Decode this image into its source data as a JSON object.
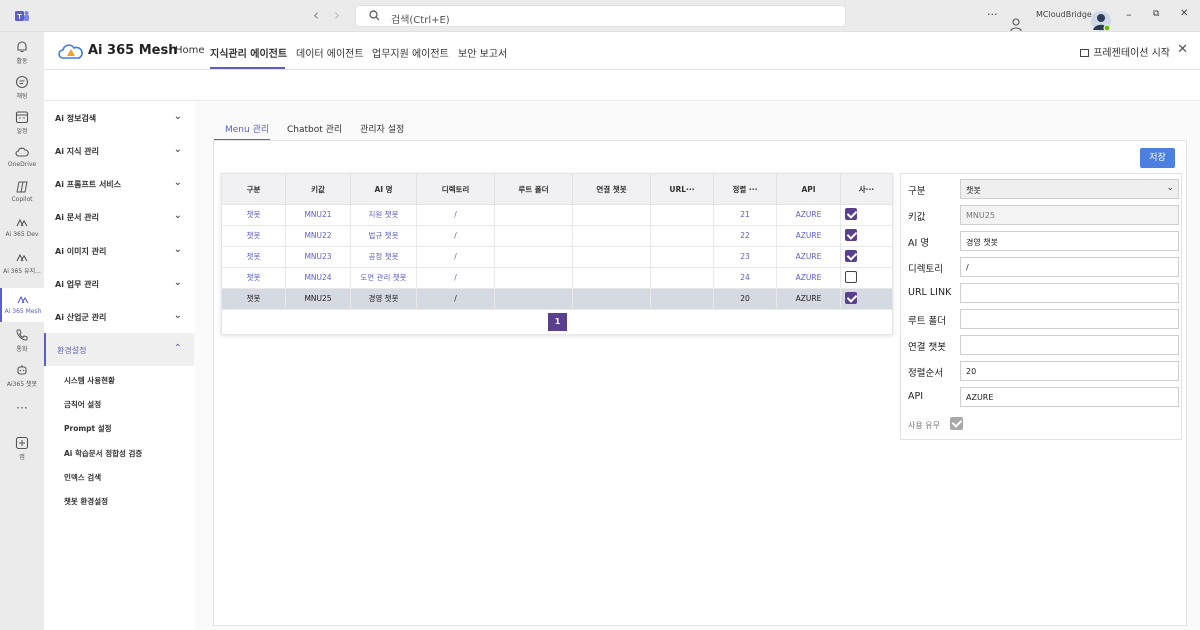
{
  "titlebar": {
    "search_placeholder": "검색(Ctrl+E)",
    "account": "MCloudBridge",
    "more": "···",
    "minimize": "–",
    "restore": "⧉",
    "close": "✕"
  },
  "rail": [
    {
      "label": "활동",
      "icon": "bell-icon"
    },
    {
      "label": "채팅",
      "icon": "chat-icon"
    },
    {
      "label": "일정",
      "icon": "calendar-icon"
    },
    {
      "label": "OneDrive",
      "icon": "cloud-icon"
    },
    {
      "label": "Copilot",
      "icon": "copilot-icon"
    },
    {
      "label": "Ai 365 Dev",
      "icon": "mesh-icon"
    },
    {
      "label": "Ai 365 유지...",
      "icon": "mesh-icon"
    },
    {
      "label": "Ai 365 Mesh",
      "icon": "mesh-icon"
    },
    {
      "label": "통화",
      "icon": "phone-icon"
    },
    {
      "label": "Ai365 챗봇",
      "icon": "bot-icon"
    },
    {
      "label": "",
      "icon": "more-icon"
    },
    {
      "label": "앱",
      "icon": "apps-icon"
    }
  ],
  "header": {
    "brand": "Ai 365 Mesh",
    "nav": [
      "Home",
      "지식관리 에이전트",
      "데이터 에이전트",
      "업무지원 에이전트",
      "보안 보고서"
    ],
    "present": "프레젠테이션 시작",
    "close": "✕"
  },
  "sidebar": {
    "items": [
      "Ai 정보검색",
      "Ai 지식 관리",
      "Ai 프롬프트 서비스",
      "Ai 문서 관리",
      "Ai 이미지 관리",
      "Ai 업무 관리",
      "Ai 산업군 관리",
      "환경설정"
    ],
    "sub_items": [
      "시스템 사용현황",
      "금칙어 설정",
      "Prompt 설정",
      "Ai 학습문서 정합성 검증",
      "인덱스 검색",
      "챗봇 환경설정"
    ],
    "chevron_down": "⌄",
    "chevron_up": "⌃"
  },
  "tabs": [
    "Menu 관리",
    "Chatbot 관리",
    "관리자 설정"
  ],
  "save_label": "저장",
  "table": {
    "columns": [
      "구분",
      "키값",
      "AI 명",
      "디렉토리",
      "루트 폴더",
      "연결 챗봇",
      "URL···",
      "정렬 ···",
      "API",
      "사···"
    ],
    "rows": [
      {
        "cat": "챗봇",
        "key": "MNU21",
        "name": "지원 챗봇",
        "dir": "/",
        "root": "",
        "link": "",
        "url": "",
        "order": "21",
        "api": "AZURE",
        "use": true
      },
      {
        "cat": "챗봇",
        "key": "MNU22",
        "name": "법규 챗봇",
        "dir": "/",
        "root": "",
        "link": "",
        "url": "",
        "order": "22",
        "api": "AZURE",
        "use": true
      },
      {
        "cat": "챗봇",
        "key": "MNU23",
        "name": "공정 챗봇",
        "dir": "/",
        "root": "",
        "link": "",
        "url": "",
        "order": "23",
        "api": "AZURE",
        "use": true
      },
      {
        "cat": "챗봇",
        "key": "MNU24",
        "name": "도면 관리 챗봇",
        "dir": "/",
        "root": "",
        "link": "",
        "url": "",
        "order": "24",
        "api": "AZURE",
        "use": false
      },
      {
        "cat": "챗봇",
        "key": "MNU25",
        "name": "경영 챗봇",
        "dir": "/",
        "root": "",
        "link": "",
        "url": "",
        "order": "20",
        "api": "AZURE",
        "use": true
      }
    ],
    "page": "1"
  },
  "form": {
    "labels": [
      "구분",
      "키값",
      "AI 명",
      "디렉토리",
      "URL LINK",
      "루트 폴더",
      "연결 챗봇",
      "정렬순서",
      "API"
    ],
    "category": "챗봇",
    "key": "MNU25",
    "name": "경영 챗봇",
    "dir": "/",
    "url": "",
    "root": "",
    "link": "",
    "order": "20",
    "api": "AZURE",
    "use_label": "사용 유무"
  },
  "colors": {
    "accent": "#5b5fc7",
    "checkbox": "#5b3f8f",
    "save": "#4c7fe0"
  }
}
